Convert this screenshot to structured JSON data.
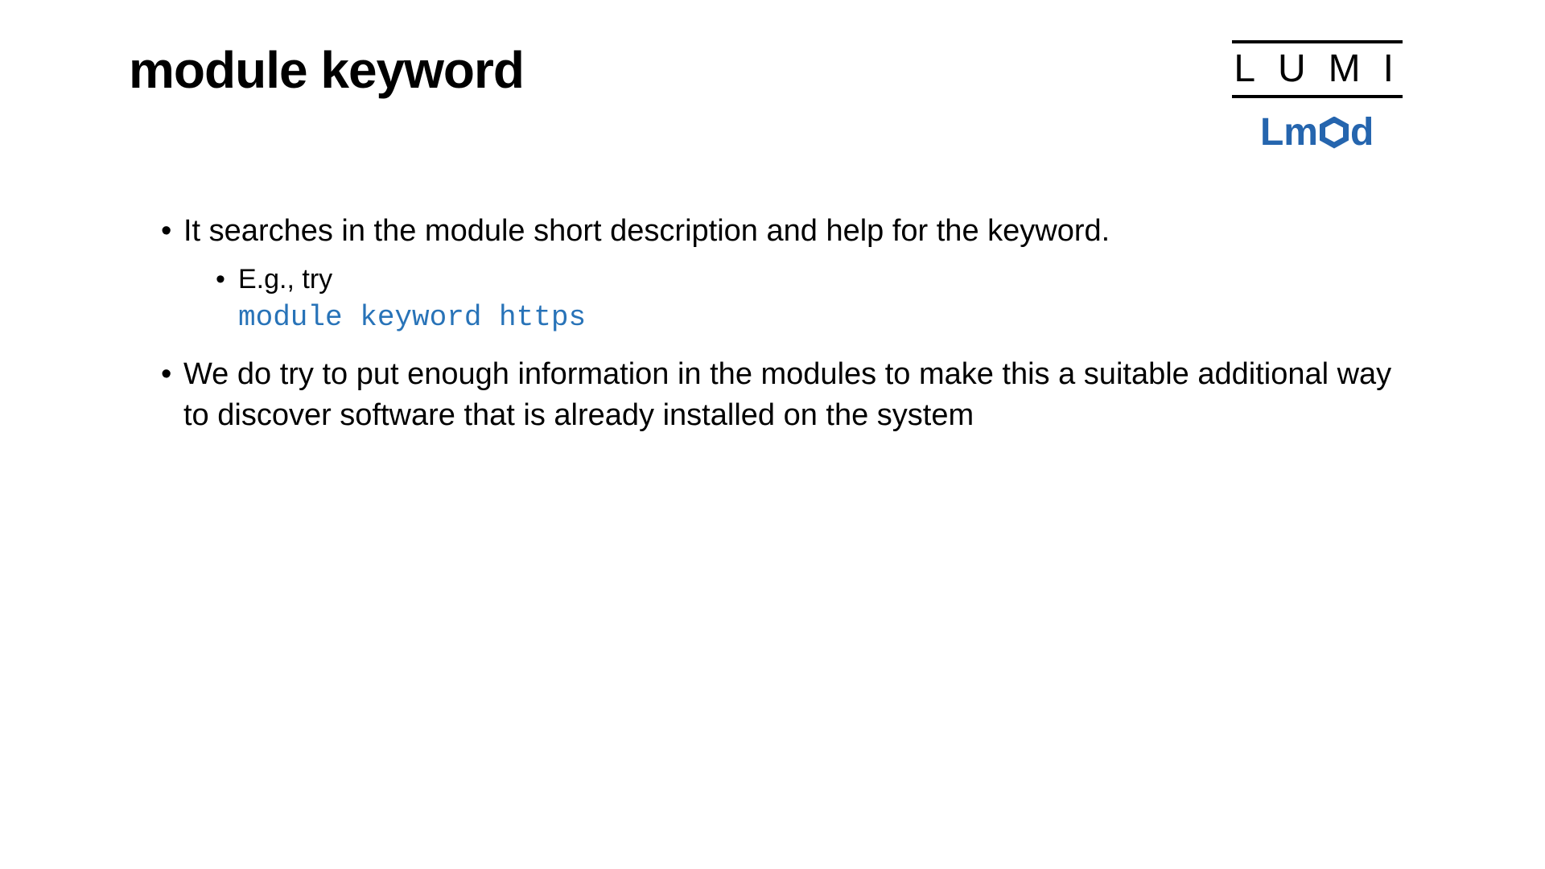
{
  "title": "module keyword",
  "logos": {
    "lumi_text": "LUMI",
    "lmod_prefix": "Lm",
    "lmod_suffix": "d"
  },
  "bullets": [
    {
      "text": "It searches in the module short description and help for the keyword.",
      "sub": [
        {
          "intro": "E.g., try",
          "code": "module keyword https"
        }
      ]
    },
    {
      "text": "We do try to put enough information in the modules to make this a suitable additional way to discover software that is already installed on the system"
    }
  ]
}
